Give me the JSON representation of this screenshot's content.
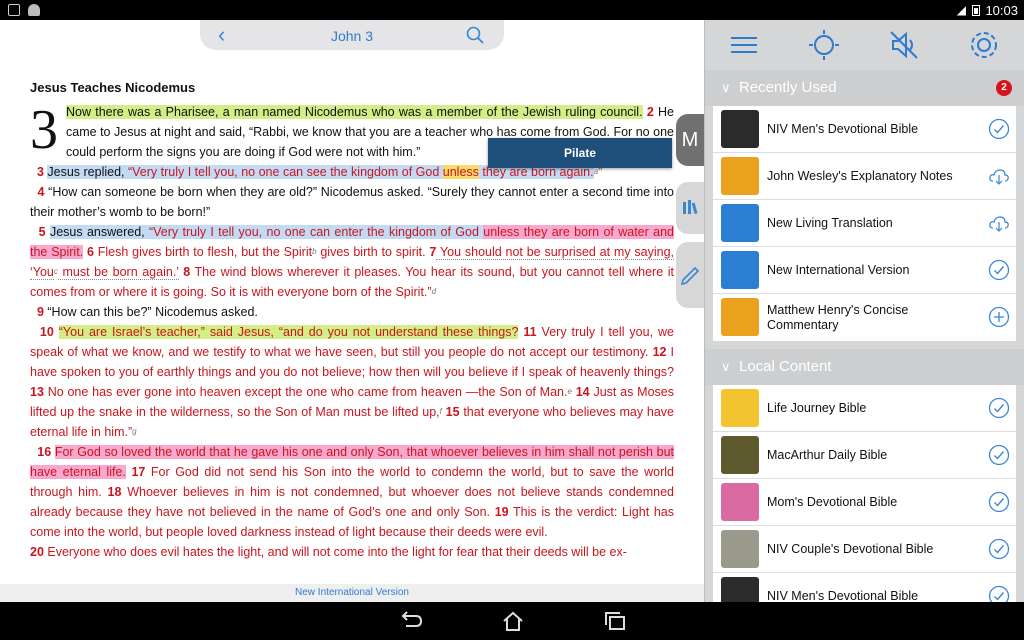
{
  "reader": {
    "title": "John 3",
    "heading": "Jesus Teaches Nicodemus",
    "chapter": "3",
    "footer": "New International Version",
    "popup_label": "Pilate",
    "sidetab_m": "M",
    "verses": {
      "v1": "Now there was a Pharisee, a man named Nicodemus who was a member of the Jewish ruling council.",
      "v2n": "2",
      "v2a": " He came to Jesus at night and said, “Rabbi, we know that you are a teacher who has come from God. For no one could perform the signs you are doing if God were not with him.”",
      "v3n": "3",
      "v3a": "Jesus replied, ",
      "v3b": "“Very truly I tell you, no one can see the kingdom of God ",
      "v3c": "unless",
      "v3d": " they are born again.",
      "v3e": "”",
      "v4n": "4",
      "v4a": " “How can someone be born when they are old?” Nicodemus asked. “Surely they cannot enter a second time into their mother’s womb to be born!”",
      "v5n": "5",
      "v5a": "Jesus answered, ",
      "v5b": "“Very truly I tell you, no one can enter the kingdom of God ",
      "v5c": "unless they are born of water and the Spirit.",
      "v6n": "6",
      "v6a": " Flesh gives birth to flesh, but the Spirit",
      "v6b": " gives birth to spirit.",
      "v7n": "7",
      "v7a": " You should not be surprised at my saying, ‘You",
      "v7b": " must be born again.’",
      "v8n": "8",
      "v8a": " The wind blows wherever it pleases. You hear its sound, but you cannot tell where it comes from or where it is going. So it is with everyone born of the Spirit.”",
      "v9n": "9",
      "v9a": " “How can this be?” Nicodemus asked.",
      "v10n": "10",
      "v10a": "“You are Israel’s teacher,” said Jesus, “and do you not understand these things?",
      "v11n": "11",
      "v11a": " Very truly I tell you, we speak of what we know, and we testify to what we have seen, but still you people do not accept our testimony.",
      "v12n": "12",
      "v12a": " I have spoken to you of earthly things and you do not believe; how then will you believe if I speak of heavenly things?",
      "v13n": "13",
      "v13a": " No one has ever gone into heaven except the one who came from heaven —the Son of Man.",
      "v14n": "14",
      "v14a": " Just as Moses lifted up the snake in the wilderness, so the Son of Man must be lifted up,",
      "v15n": "15",
      "v15a": " that everyone who believes may have eternal life in him.”",
      "v16n": "16",
      "v16a": "For God so loved the world that he gave his one and only Son, that whoever believes in him shall not perish but have eternal life.",
      "v17n": "17",
      "v17a": " For God did not send his Son into the world to condemn the world, but to save the world through him.",
      "v18n": "18",
      "v18a": " Whoever believes in him is not condemned, but whoever does not believe stands condemned already because they have not believed in the name of God’s one and only Son.",
      "v19n": "19",
      "v19a": " This is the verdict: Light has come into the world, but people loved darkness instead of light because their deeds were evil.",
      "v20n": "20",
      "v20a": " Everyone who does evil hates the light, and will not come into the light for fear that their deeds will be ex-"
    },
    "footnotes": {
      "a": "a",
      "b": "b",
      "c": "c",
      "d": "d",
      "e": "e",
      "f": "f",
      "g": "g"
    }
  },
  "panel": {
    "recent_title": "Recently Used",
    "recent_badge": "2",
    "recent_items": [
      {
        "label": "NIV Men's Devotional Bible",
        "action": "check-circle-icon"
      },
      {
        "label": "John Wesley's Explanatory Notes",
        "action": "cloud-download-icon"
      },
      {
        "label": "New Living Translation",
        "action": "cloud-download-icon"
      },
      {
        "label": "New International Version",
        "action": "check-circle-icon"
      },
      {
        "label": "Matthew Henry's Concise Commentary",
        "action": "add-circle-icon"
      }
    ],
    "local_title": "Local Content",
    "local_items": [
      {
        "label": "Life Journey Bible",
        "action": "check-circle-icon"
      },
      {
        "label": "MacArthur Daily Bible",
        "action": "check-circle-icon"
      },
      {
        "label": "Mom's Devotional Bible",
        "action": "check-circle-icon"
      },
      {
        "label": "NIV Couple's Devotional Bible",
        "action": "check-circle-icon"
      },
      {
        "label": "NIV Men's Devotional Bible",
        "action": "check-circle-icon"
      }
    ]
  },
  "status": {
    "time": "10:03"
  },
  "colors": {
    "accent": "#2f7bd0",
    "red_letter": "#c8161d",
    "badge": "#d7131c",
    "popup": "#1d4f7a"
  }
}
